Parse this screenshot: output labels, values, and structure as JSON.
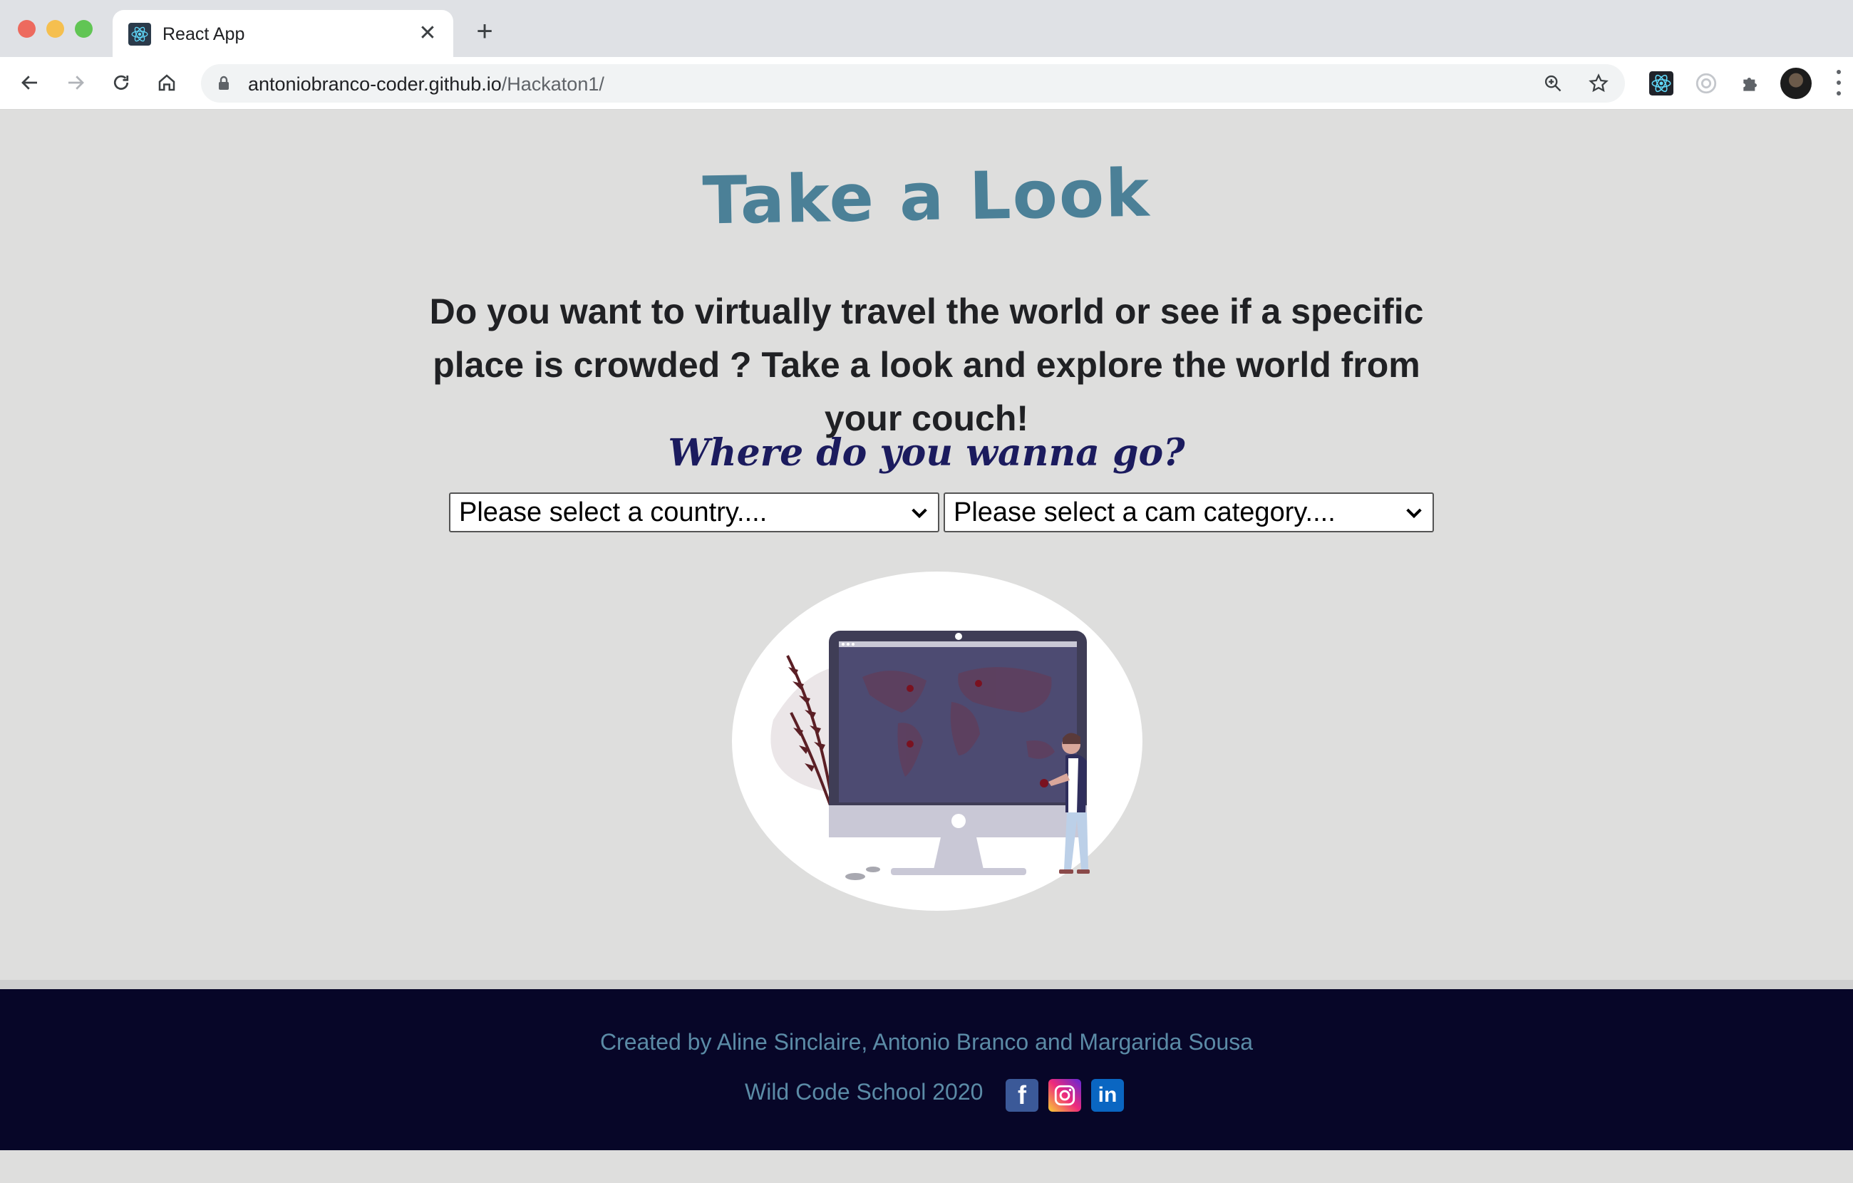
{
  "browser": {
    "tab_title": "React App",
    "url_host": "antoniobranco-coder.github.io",
    "url_path": "/Hackaton1/",
    "icons": [
      "back-icon",
      "forward-icon",
      "reload-icon",
      "home-icon",
      "lock-icon",
      "zoom-icon",
      "bookmark-star-icon",
      "react-devtools-icon",
      "extension-icon",
      "puzzle-icon",
      "profile-avatar",
      "menu-icon"
    ]
  },
  "page": {
    "title": "Take a Look",
    "intro": "Do you want to virtually travel the world or see if a specific place is crowded ? Take a look and explore the world from your couch!",
    "question": "Where do you wanna go?",
    "country_select": {
      "selected": "Please select a country...."
    },
    "category_select": {
      "selected": "Please select a cam category...."
    }
  },
  "footer": {
    "credits": "Created by Aline Sinclaire, Antonio Branco and Margarida Sousa",
    "school": "Wild Code School 2020",
    "social": [
      "facebook-icon",
      "instagram-icon",
      "linkedin-icon"
    ]
  },
  "colors": {
    "title": "#4b8097",
    "question": "#1b1b5e",
    "footer_bg": "#070628",
    "footer_text": "#5b8ba6",
    "page_bg": "#dededd"
  }
}
